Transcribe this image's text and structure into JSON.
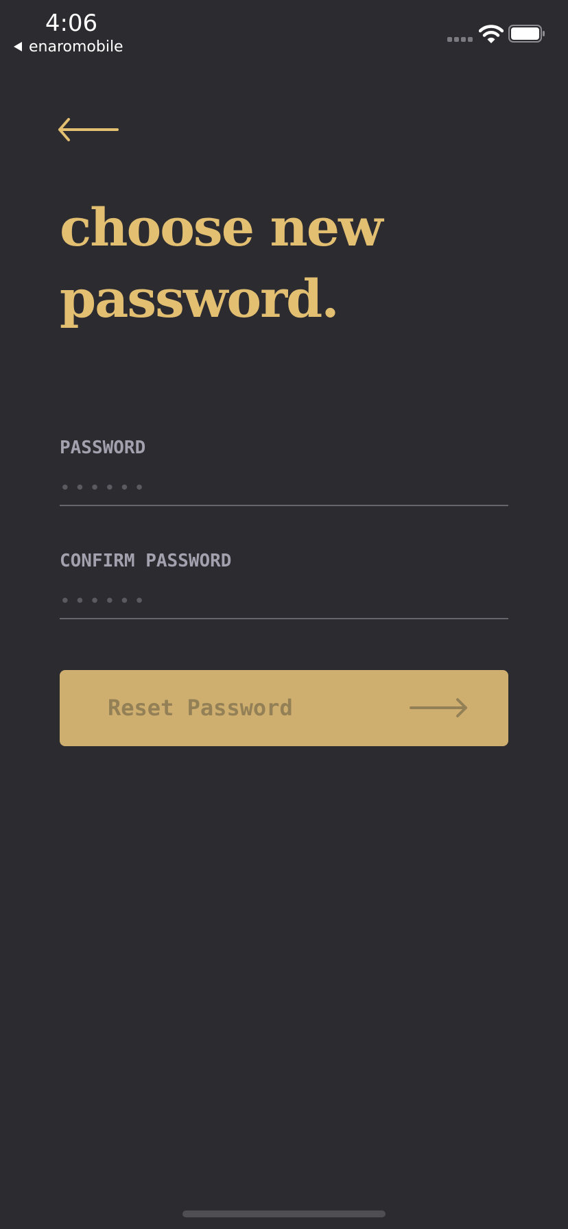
{
  "status_bar": {
    "time": "4:06",
    "back_app_label": "enaromobile",
    "icons": [
      "signal-icon",
      "wifi-icon",
      "battery-icon"
    ]
  },
  "nav": {
    "back_icon": "arrow-left-icon"
  },
  "headline": "choose new password.",
  "form": {
    "password": {
      "label": "PASSWORD",
      "placeholder": "••••••",
      "value": ""
    },
    "confirm_password": {
      "label": "CONFIRM PASSWORD",
      "placeholder": "••••••",
      "value": ""
    }
  },
  "reset_button": {
    "label": "Reset Password",
    "icon": "arrow-right-icon"
  },
  "colors": {
    "background": "#2c2b30",
    "accent": "#e3bf72",
    "button": "#cfaf6f",
    "button_text": "#938056",
    "label": "#a3a1ad",
    "divider": "#67666c"
  }
}
